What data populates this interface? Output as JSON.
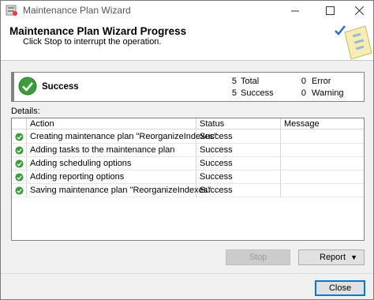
{
  "window": {
    "title": "Maintenance Plan Wizard"
  },
  "header": {
    "title": "Maintenance Plan Wizard Progress",
    "subtitle": "Click Stop to interrupt the operation."
  },
  "summary": {
    "state": "Success",
    "total_count": "5",
    "total_label": "Total",
    "success_count": "5",
    "success_label": "Success",
    "error_count": "0",
    "error_label": "Error",
    "warning_count": "0",
    "warning_label": "Warning"
  },
  "details": {
    "label": "Details:",
    "columns": {
      "action": "Action",
      "status": "Status",
      "message": "Message"
    },
    "rows": [
      {
        "action": "Creating maintenance plan \"ReorganizeIndexes\"",
        "status": "Success",
        "message": ""
      },
      {
        "action": "Adding tasks to the maintenance plan",
        "status": "Success",
        "message": ""
      },
      {
        "action": "Adding scheduling options",
        "status": "Success",
        "message": ""
      },
      {
        "action": "Adding reporting options",
        "status": "Success",
        "message": ""
      },
      {
        "action": "Saving maintenance plan \"ReorganizeIndexes\"",
        "status": "Success",
        "message": ""
      }
    ]
  },
  "buttons": {
    "stop": "Stop",
    "report": "Report",
    "close": "Close"
  },
  "icons": {
    "status_success": "check-circle-icon",
    "accent": "#2e9a2e"
  }
}
